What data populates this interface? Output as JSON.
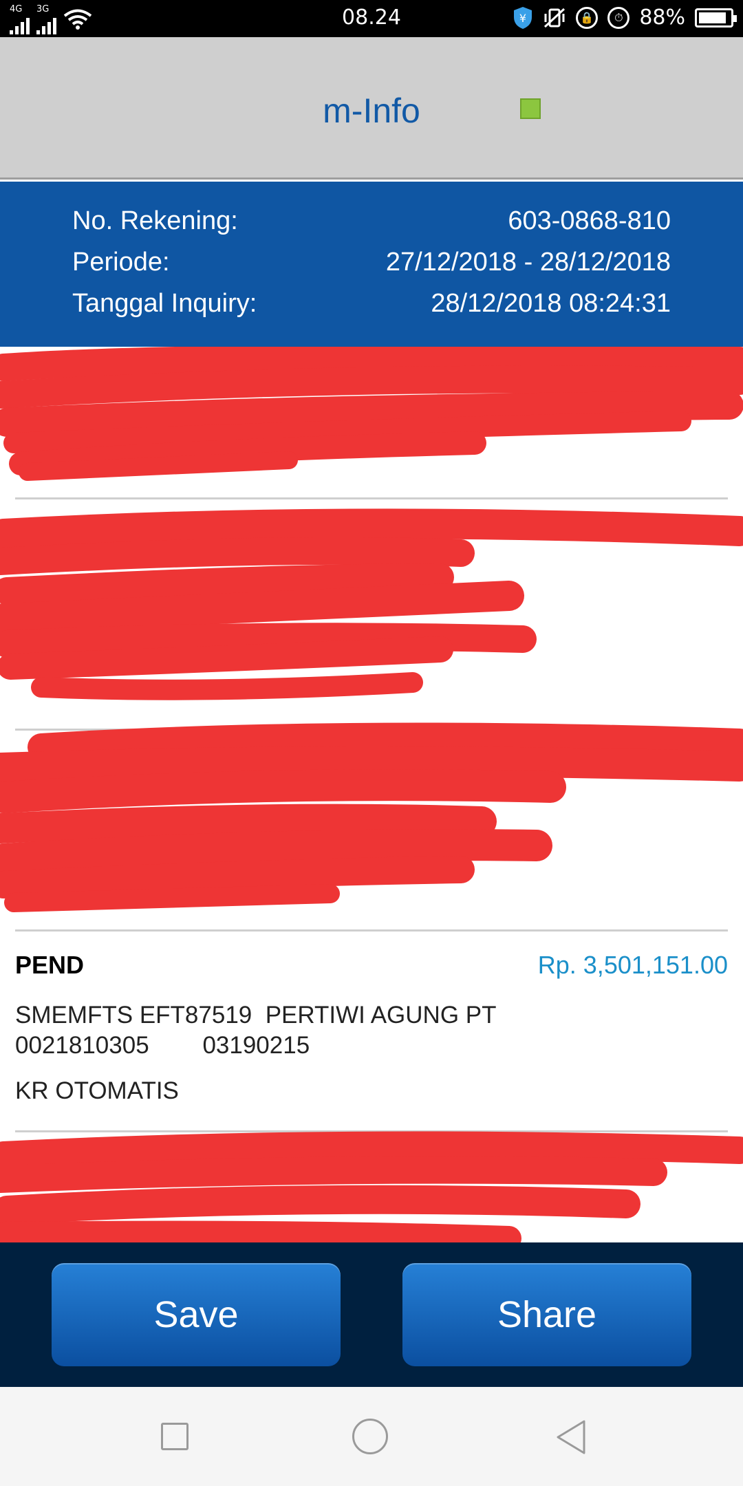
{
  "status_bar": {
    "network_1": "4G",
    "network_2": "3G",
    "time": "08.24",
    "battery": "88%"
  },
  "header": {
    "title": "m-Info"
  },
  "account_info": {
    "rows": [
      {
        "label": "No. Rekening:",
        "value": "603-0868-810"
      },
      {
        "label": "Periode:",
        "value": "27/12/2018 - 28/12/2018"
      },
      {
        "label": "Tanggal Inquiry:",
        "value": "28/12/2018 08:24:31"
      }
    ]
  },
  "transactions": [
    {
      "type": "PEND",
      "amount": "Rp. 3,501,151.00",
      "description_line1": "SMEMFTS EFT87519  PERTIWI AGUNG PT",
      "description_line2": "0021810305        03190215",
      "note": "KR OTOMATIS"
    }
  ],
  "buttons": {
    "save_label": "Save",
    "share_label": "Share"
  },
  "colors": {
    "header_bg": "#cfcfcf",
    "title": "#1159a6",
    "info_bg": "#0f56a3",
    "credit_amount": "#1a8fc9",
    "action_bar_bg": "#00203f",
    "redaction": "#ee3535"
  }
}
